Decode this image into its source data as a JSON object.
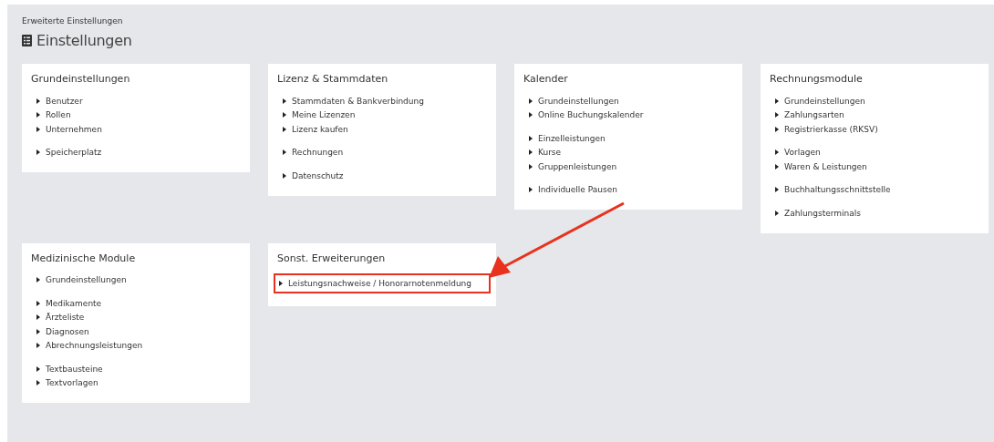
{
  "breadcrumb": "Erweiterte Einstellungen",
  "page_title": "Einstellungen",
  "cards": [
    {
      "title": "Grundeinstellungen",
      "groups": [
        [
          {
            "label": "Benutzer",
            "highlighted": false
          },
          {
            "label": "Rollen",
            "highlighted": false
          },
          {
            "label": "Unternehmen",
            "highlighted": false
          }
        ],
        [
          {
            "label": "Speicherplatz",
            "highlighted": false
          }
        ]
      ]
    },
    {
      "title": "Lizenz & Stammdaten",
      "groups": [
        [
          {
            "label": "Stammdaten & Bankverbindung",
            "highlighted": false
          },
          {
            "label": "Meine Lizenzen",
            "highlighted": false
          },
          {
            "label": "Lizenz kaufen",
            "highlighted": false
          }
        ],
        [
          {
            "label": "Rechnungen",
            "highlighted": false
          }
        ],
        [
          {
            "label": "Datenschutz",
            "highlighted": false
          }
        ]
      ]
    },
    {
      "title": "Kalender",
      "groups": [
        [
          {
            "label": "Grundeinstellungen",
            "highlighted": false
          },
          {
            "label": "Online Buchungskalender",
            "highlighted": false
          }
        ],
        [
          {
            "label": "Einzelleistungen",
            "highlighted": false
          },
          {
            "label": "Kurse",
            "highlighted": false
          },
          {
            "label": "Gruppenleistungen",
            "highlighted": false
          }
        ],
        [
          {
            "label": "Individuelle Pausen",
            "highlighted": false
          }
        ]
      ]
    },
    {
      "title": "Rechnungsmodule",
      "groups": [
        [
          {
            "label": "Grundeinstellungen",
            "highlighted": false
          },
          {
            "label": "Zahlungsarten",
            "highlighted": false
          },
          {
            "label": "Registrierkasse (RKSV)",
            "highlighted": false
          }
        ],
        [
          {
            "label": "Vorlagen",
            "highlighted": false
          },
          {
            "label": "Waren & Leistungen",
            "highlighted": false
          }
        ],
        [
          {
            "label": "Buchhaltungsschnittstelle",
            "highlighted": false
          }
        ],
        [
          {
            "label": "Zahlungsterminals",
            "highlighted": false
          }
        ]
      ]
    },
    {
      "title": "Medizinische Module",
      "groups": [
        [
          {
            "label": "Grundeinstellungen",
            "highlighted": false
          }
        ],
        [
          {
            "label": "Medikamente",
            "highlighted": false
          },
          {
            "label": "Ärzteliste",
            "highlighted": false
          },
          {
            "label": "Diagnosen",
            "highlighted": false
          },
          {
            "label": "Abrechnungsleistungen",
            "highlighted": false
          }
        ],
        [
          {
            "label": "Textbausteine",
            "highlighted": false
          },
          {
            "label": "Textvorlagen",
            "highlighted": false
          }
        ]
      ]
    },
    {
      "title": "Sonst. Erweiterungen",
      "groups": [
        [
          {
            "label": "Leistungsnachweise / Honorarnotenmeldung",
            "highlighted": true
          }
        ]
      ]
    }
  ]
}
